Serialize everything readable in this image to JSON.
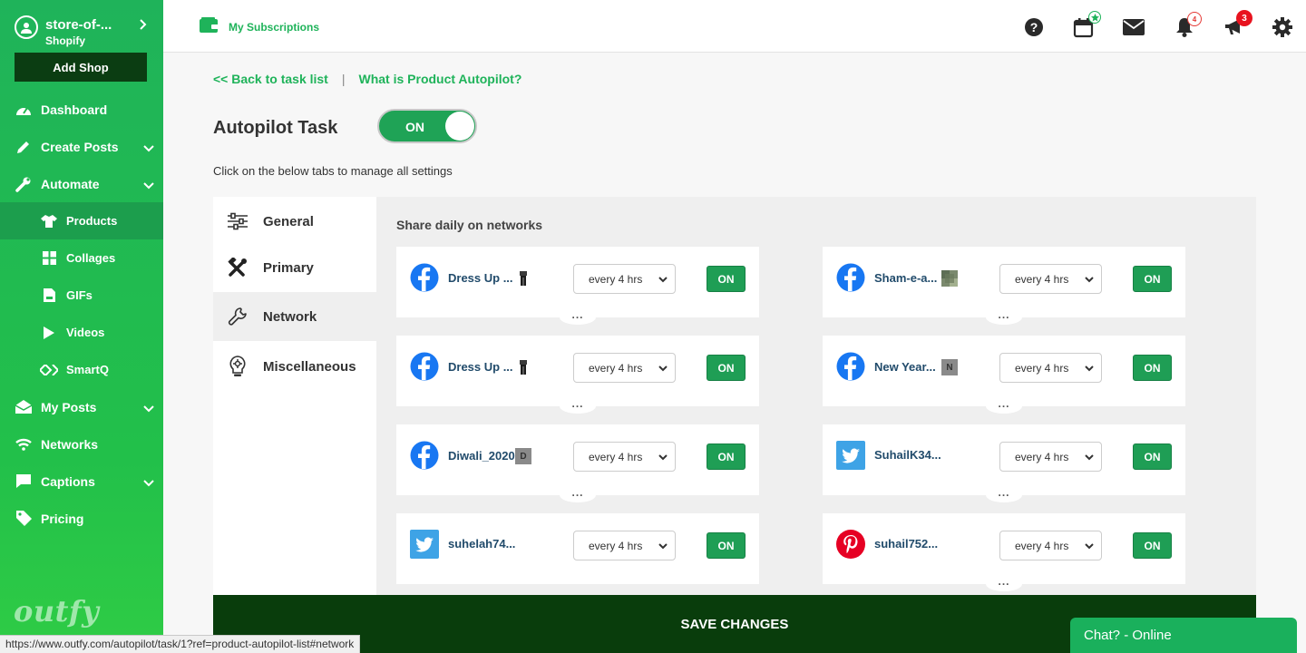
{
  "sidebar": {
    "store_name": "store-of-...",
    "platform": "Shopify",
    "add_shop": "Add Shop",
    "items": [
      {
        "label": "Dashboard"
      },
      {
        "label": "Create Posts"
      },
      {
        "label": "Automate"
      },
      {
        "label": "Products"
      },
      {
        "label": "Collages"
      },
      {
        "label": "GIFs"
      },
      {
        "label": "Videos"
      },
      {
        "label": "SmartQ"
      },
      {
        "label": "My Posts"
      },
      {
        "label": "Networks"
      },
      {
        "label": "Captions"
      },
      {
        "label": "Pricing"
      }
    ],
    "brand": "outfy"
  },
  "header": {
    "subscriptions": "My Subscriptions",
    "notifications_count": "4",
    "announcements_count": "3"
  },
  "links": {
    "back": "<< Back to task list",
    "separator": "|",
    "what_is": "What is Product Autopilot?"
  },
  "task": {
    "title": "Autopilot Task",
    "toggle_label": "ON",
    "description": "Click on the below tabs to manage all settings"
  },
  "tabs": [
    {
      "label": "General"
    },
    {
      "label": "Primary"
    },
    {
      "label": "Network"
    },
    {
      "label": "Miscellaneous"
    }
  ],
  "panel": {
    "title": "Share daily on networks",
    "more": "...",
    "cards": [
      {
        "network": "facebook",
        "account": "Dress Up ...",
        "frequency": "every 4 hrs",
        "status": "ON"
      },
      {
        "network": "facebook",
        "account": "Sham-e-a...",
        "frequency": "every 4 hrs",
        "status": "ON"
      },
      {
        "network": "facebook",
        "account": "Dress Up ...",
        "frequency": "every 4 hrs",
        "status": "ON"
      },
      {
        "network": "facebook",
        "account": "New Year...",
        "frequency": "every 4 hrs",
        "status": "ON",
        "thumb": "N"
      },
      {
        "network": "facebook",
        "account": "Diwali_2020",
        "frequency": "every 4 hrs",
        "status": "ON",
        "thumb": "D"
      },
      {
        "network": "twitter",
        "account": "SuhailK34...",
        "frequency": "every 4 hrs",
        "status": "ON"
      },
      {
        "network": "twitter",
        "account": "suhelah74...",
        "frequency": "every 4 hrs",
        "status": "ON"
      },
      {
        "network": "pinterest",
        "account": "suhail752...",
        "frequency": "every 4 hrs",
        "status": "ON"
      }
    ]
  },
  "save_button": "SAVE CHANGES",
  "chat": "Chat? - Online",
  "status_url": "https://www.outfy.com/autopilot/task/1?ref=product-autopilot-list#network",
  "colors": {
    "brand_green": "#1fb35a",
    "dark_green": "#093d0c",
    "facebook": "#1877f2",
    "twitter": "#1da1f2",
    "pinterest": "#e60023"
  }
}
